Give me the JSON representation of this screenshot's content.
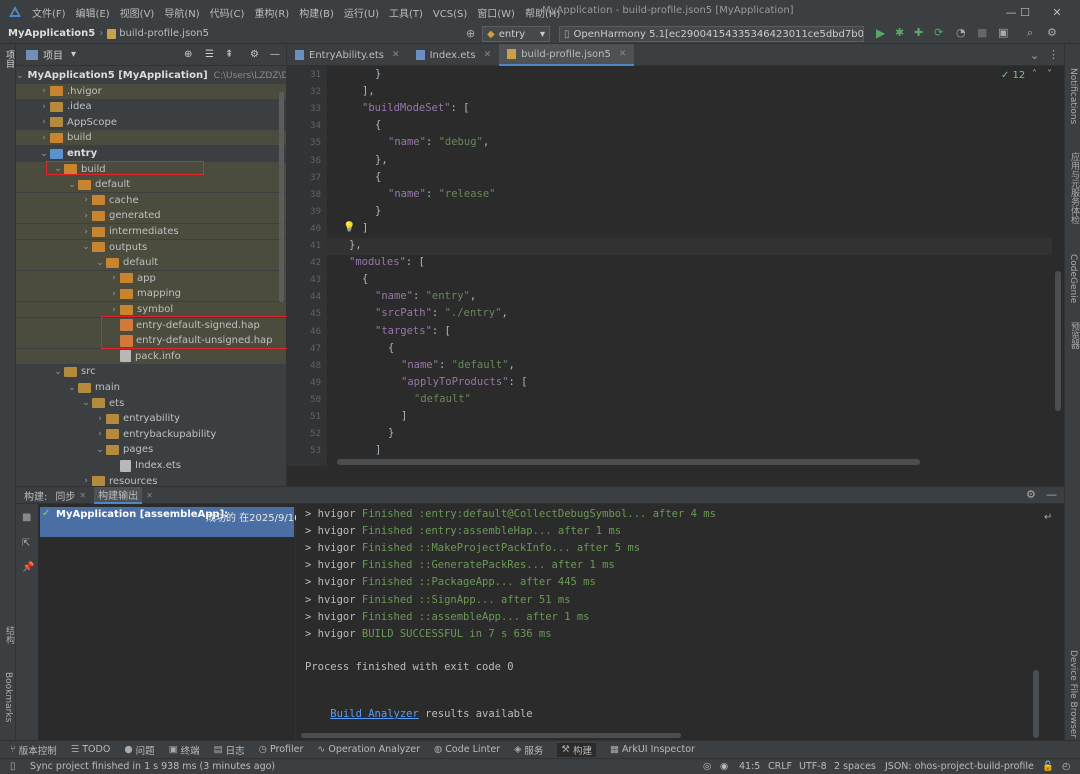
{
  "window": {
    "menu": [
      "文件(F)",
      "编辑(E)",
      "视图(V)",
      "导航(N)",
      "代码(C)",
      "重构(R)",
      "构建(B)",
      "运行(U)",
      "工具(T)",
      "VCS(S)",
      "窗口(W)",
      "帮助(H)"
    ],
    "title": "MyApplication - build-profile.json5 [MyApplication]",
    "min": "—",
    "max": "☐",
    "close": "✕"
  },
  "nav": {
    "project": "MyApplication5",
    "file": "build-profile.json5",
    "module_dropdown": "entry",
    "device_dropdown": "OpenHarmony 5.1[ec290041543353464230​11ce5dbd7b00]"
  },
  "project_panel": {
    "title": "项目",
    "tree": [
      {
        "depth": 0,
        "open": true,
        "kind": "root",
        "label": "MyApplication5 [MyApplication]",
        "hint": "C:\\Users\\LZDZ\\De"
      },
      {
        "depth": 1,
        "open": false,
        "kind": "folder-orange",
        "label": ".hvigor",
        "hl": true
      },
      {
        "depth": 1,
        "open": false,
        "kind": "folder",
        "label": ".idea"
      },
      {
        "depth": 1,
        "open": false,
        "kind": "folder",
        "label": "AppScope"
      },
      {
        "depth": 1,
        "open": false,
        "kind": "folder-orange",
        "label": "build",
        "hl": true
      },
      {
        "depth": 1,
        "open": true,
        "kind": "folder-blue",
        "label": "entry",
        "bold": true
      },
      {
        "depth": 2,
        "open": true,
        "kind": "folder-orange",
        "label": "build",
        "hl": true
      },
      {
        "depth": 3,
        "open": true,
        "kind": "folder-orange",
        "label": "default",
        "hl": true
      },
      {
        "depth": 4,
        "open": false,
        "kind": "folder-orange",
        "label": "cache",
        "hl": true
      },
      {
        "depth": 4,
        "open": false,
        "kind": "folder-orange",
        "label": "generated",
        "hl": true
      },
      {
        "depth": 4,
        "open": false,
        "kind": "folder-orange",
        "label": "intermediates",
        "hl": true
      },
      {
        "depth": 4,
        "open": true,
        "kind": "folder-orange",
        "label": "outputs",
        "hl": true
      },
      {
        "depth": 5,
        "open": true,
        "kind": "folder-orange",
        "label": "default",
        "hl": true
      },
      {
        "depth": 6,
        "open": false,
        "kind": "folder-orange",
        "label": "app",
        "hl": true
      },
      {
        "depth": 6,
        "open": false,
        "kind": "folder-orange",
        "label": "mapping",
        "hl": true
      },
      {
        "depth": 6,
        "open": false,
        "kind": "folder-orange",
        "label": "symbol",
        "hl": true
      },
      {
        "depth": 6,
        "open": null,
        "kind": "hap",
        "label": "entry-default-signed.hap",
        "hl": true
      },
      {
        "depth": 6,
        "open": null,
        "kind": "hap",
        "label": "entry-default-unsigned.hap",
        "hl": true
      },
      {
        "depth": 6,
        "open": null,
        "kind": "file",
        "label": "pack.info",
        "hl": true
      },
      {
        "depth": 2,
        "open": true,
        "kind": "folder",
        "label": "src"
      },
      {
        "depth": 3,
        "open": true,
        "kind": "folder",
        "label": "main"
      },
      {
        "depth": 4,
        "open": true,
        "kind": "folder",
        "label": "ets"
      },
      {
        "depth": 5,
        "open": false,
        "kind": "folder",
        "label": "entryability"
      },
      {
        "depth": 5,
        "open": false,
        "kind": "folder",
        "label": "entrybackupability"
      },
      {
        "depth": 5,
        "open": true,
        "kind": "folder",
        "label": "pages"
      },
      {
        "depth": 6,
        "open": null,
        "kind": "file",
        "label": "Index.ets"
      },
      {
        "depth": 4,
        "open": false,
        "kind": "folder",
        "label": "resources"
      }
    ]
  },
  "tabs": [
    {
      "label": "EntryAbility.ets",
      "active": false
    },
    {
      "label": "Index.ets",
      "active": false
    },
    {
      "label": "build-profile.json5",
      "active": true
    }
  ],
  "editor": {
    "inspection": "✓ 12",
    "lines": [
      {
        "n": "31",
        "indent": 2,
        "parts": [
          [
            "p",
            "}"
          ]
        ]
      },
      {
        "n": "32",
        "indent": 1,
        "parts": [
          [
            "p",
            "],"
          ]
        ]
      },
      {
        "n": "33",
        "indent": 1,
        "parts": [
          [
            "k",
            "\"buildModeSet\""
          ],
          [
            "p",
            ": ["
          ]
        ]
      },
      {
        "n": "34",
        "indent": 2,
        "parts": [
          [
            "p",
            "{"
          ]
        ]
      },
      {
        "n": "35",
        "indent": 3,
        "parts": [
          [
            "k",
            "\"name\""
          ],
          [
            "p",
            ": "
          ],
          [
            "s",
            "\"debug\""
          ],
          [
            "p",
            ","
          ]
        ]
      },
      {
        "n": "36",
        "indent": 2,
        "parts": [
          [
            "p",
            "},"
          ]
        ]
      },
      {
        "n": "37",
        "indent": 2,
        "parts": [
          [
            "p",
            "{"
          ]
        ]
      },
      {
        "n": "38",
        "indent": 3,
        "parts": [
          [
            "k",
            "\"name\""
          ],
          [
            "p",
            ": "
          ],
          [
            "s",
            "\"release\""
          ]
        ]
      },
      {
        "n": "39",
        "indent": 2,
        "parts": [
          [
            "p",
            "}"
          ]
        ]
      },
      {
        "n": "40",
        "indent": 1,
        "parts": [
          [
            "p",
            "]"
          ]
        ]
      },
      {
        "n": "41",
        "indent": 0,
        "parts": [
          [
            "p",
            "},"
          ]
        ]
      },
      {
        "n": "42",
        "indent": 0,
        "parts": [
          [
            "k",
            "\"modules\""
          ],
          [
            "p",
            ": ["
          ]
        ]
      },
      {
        "n": "43",
        "indent": 1,
        "parts": [
          [
            "p",
            "{"
          ]
        ]
      },
      {
        "n": "44",
        "indent": 2,
        "parts": [
          [
            "k",
            "\"name\""
          ],
          [
            "p",
            ": "
          ],
          [
            "s",
            "\"entry\""
          ],
          [
            "p",
            ","
          ]
        ]
      },
      {
        "n": "45",
        "indent": 2,
        "parts": [
          [
            "k",
            "\"srcPath\""
          ],
          [
            "p",
            ": "
          ],
          [
            "s",
            "\"./entry\""
          ],
          [
            "p",
            ","
          ]
        ]
      },
      {
        "n": "46",
        "indent": 2,
        "parts": [
          [
            "k",
            "\"targets\""
          ],
          [
            "p",
            ": ["
          ]
        ]
      },
      {
        "n": "47",
        "indent": 3,
        "parts": [
          [
            "p",
            "{"
          ]
        ]
      },
      {
        "n": "48",
        "indent": 4,
        "parts": [
          [
            "k",
            "\"name\""
          ],
          [
            "p",
            ": "
          ],
          [
            "s",
            "\"default\""
          ],
          [
            "p",
            ","
          ]
        ]
      },
      {
        "n": "49",
        "indent": 4,
        "parts": [
          [
            "k",
            "\"applyToProducts\""
          ],
          [
            "p",
            ": ["
          ]
        ]
      },
      {
        "n": "50",
        "indent": 5,
        "parts": [
          [
            "s",
            "\"default\""
          ]
        ]
      },
      {
        "n": "51",
        "indent": 4,
        "parts": [
          [
            "p",
            "]"
          ]
        ]
      },
      {
        "n": "52",
        "indent": 3,
        "parts": [
          [
            "p",
            "}"
          ]
        ]
      },
      {
        "n": "53",
        "indent": 2,
        "parts": [
          [
            "p",
            "]"
          ]
        ]
      }
    ]
  },
  "build_panel": {
    "tabs": [
      "构建:",
      "同步",
      "构建输出"
    ],
    "entry_title": "MyApplication [assembleApp]:",
    "entry_status": "成功的 在2025/9/16",
    "console": [
      {
        "pre": "> hvigor ",
        "g": "Finished :entry:default@CollectDebugSymbol... after 4 ms"
      },
      {
        "pre": "> hvigor ",
        "g": "Finished :entry:assembleHap... after 1 ms"
      },
      {
        "pre": "> hvigor ",
        "g": "Finished ::MakeProjectPackInfo... after 5 ms"
      },
      {
        "pre": "> hvigor ",
        "g": "Finished ::GeneratePackRes... after 1 ms"
      },
      {
        "pre": "> hvigor ",
        "g": "Finished ::PackageApp... after 445 ms"
      },
      {
        "pre": "> hvigor ",
        "g": "Finished ::SignApp... after 51 ms"
      },
      {
        "pre": "> hvigor ",
        "g": "Finished ::assembleApp... after 1 ms"
      },
      {
        "pre": "> hvigor ",
        "g": "BUILD SUCCESSFUL in 7 s 636 ms"
      }
    ],
    "exit": "Process finished with exit code 0",
    "analyzer_link": "Build Analyzer",
    "analyzer_rest": " results available"
  },
  "left_strip": {
    "project": "项目",
    "structure": "结构",
    "bookmarks": "Bookmarks"
  },
  "right_strip": {
    "notifications": "Notifications",
    "cloud": "应用与元服务体检",
    "codegenie": "CodeGenie",
    "preview": "预览器",
    "device": "Device File Browser"
  },
  "tool_windows": [
    {
      "icon": "⑂",
      "label": "版本控制"
    },
    {
      "icon": "☰",
      "label": "TODO"
    },
    {
      "icon": "●",
      "label": "问题"
    },
    {
      "icon": "▣",
      "label": "终端"
    },
    {
      "icon": "▤",
      "label": "日志"
    },
    {
      "icon": "◷",
      "label": "Profiler"
    },
    {
      "icon": "∿",
      "label": "Operation Analyzer"
    },
    {
      "icon": "◍",
      "label": "Code Linter"
    },
    {
      "icon": "◈",
      "label": "服务"
    },
    {
      "icon": "⚒",
      "label": "构建",
      "active": true
    },
    {
      "icon": "▦",
      "label": "ArkUI Inspector"
    }
  ],
  "status": {
    "message": "Sync project finished in 1 s 938 ms (3 minutes ago)",
    "position": "41:5",
    "line_sep": "CRLF",
    "encoding": "UTF-8",
    "indent": "2 spaces",
    "schema": "JSON: ohos-project-build-profile"
  },
  "colors": {
    "accent": "#4a88c7",
    "folder_orange": "#c9842f",
    "folder_blue": "#5a93cc",
    "folder_default": "#b58a3d",
    "selection": "#4a6fa5",
    "highlight": "#e0242a"
  }
}
